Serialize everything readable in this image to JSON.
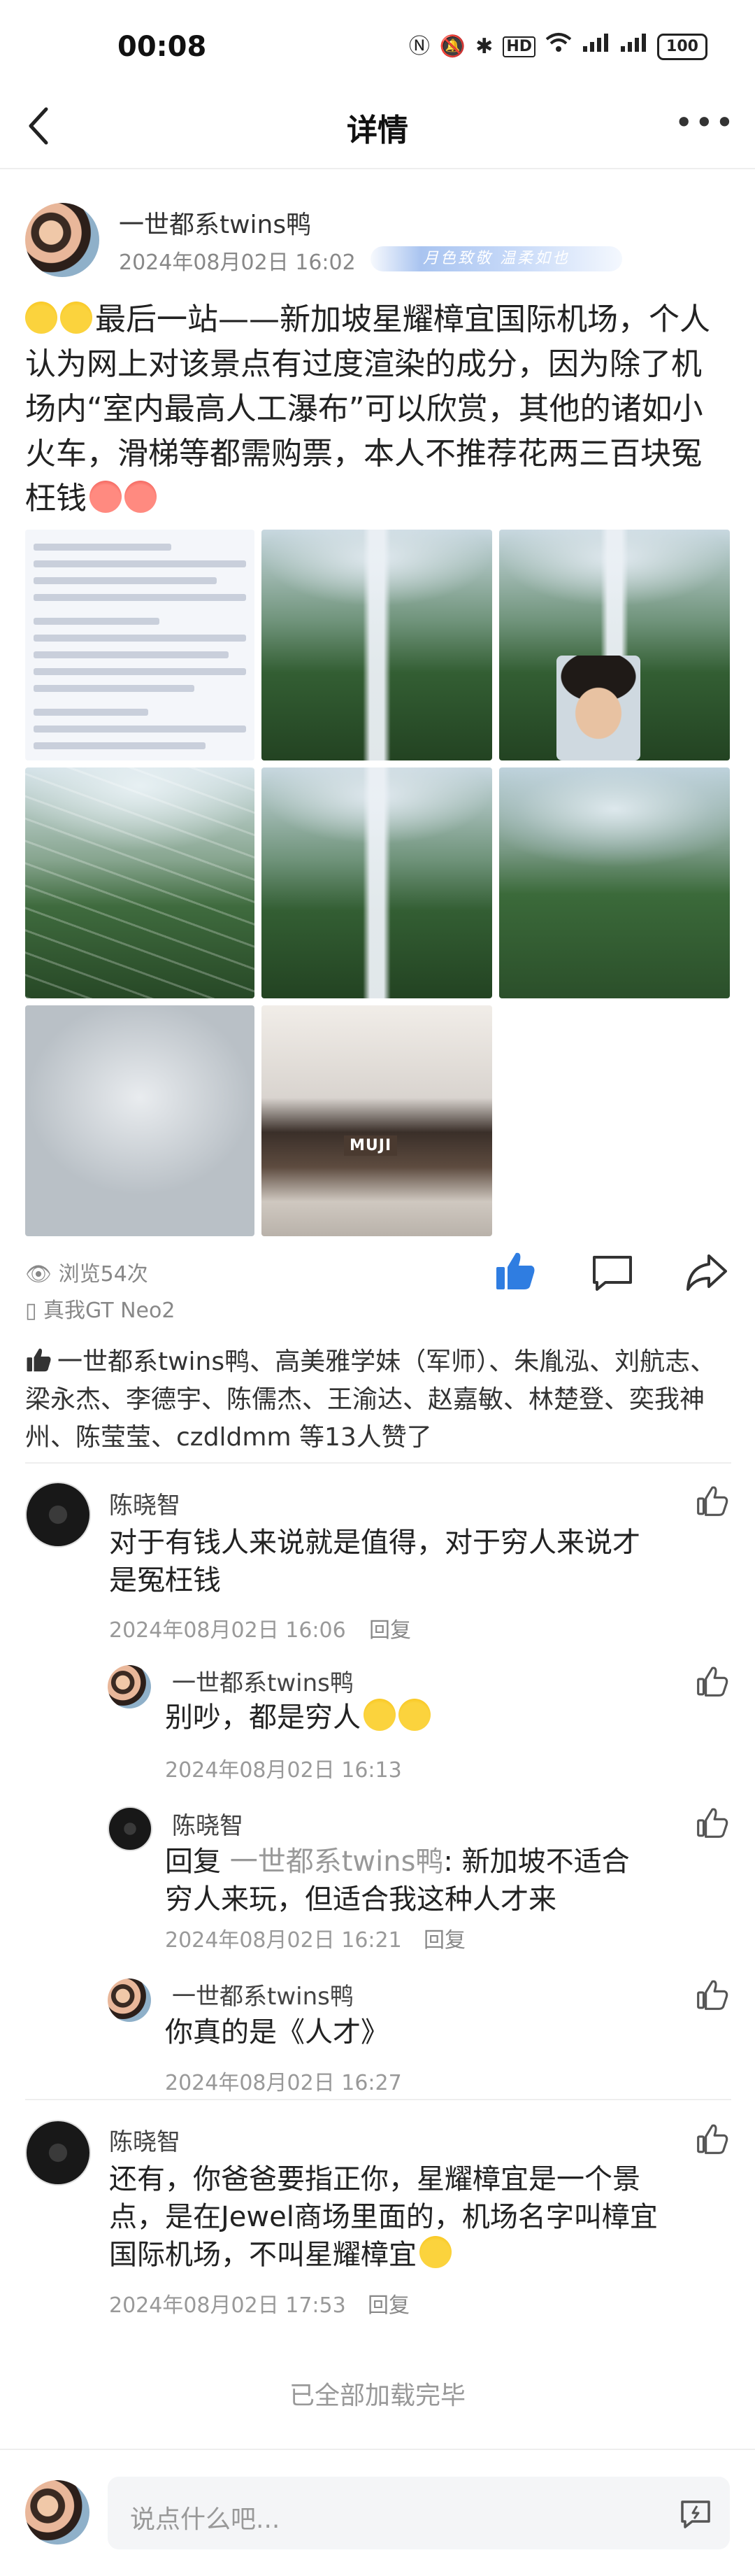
{
  "status_bar": {
    "time": "00:08",
    "icons": [
      "nfc-icon",
      "mute-icon",
      "bluetooth-icon",
      "hd-icon",
      "wifi-icon",
      "signal-4g-icon",
      "signal-5g-icon"
    ],
    "hd_label": "HD",
    "battery": "100"
  },
  "nav": {
    "title": "详情",
    "more": "•••"
  },
  "post": {
    "author": "一世都系twins鸭",
    "time": "2024年08月02日 16:02",
    "badge_text": "月色致敬  温柔如也",
    "body": "最后一站——新加坡星耀樟宜国际机场，个人认为网上对该景点有过度渲染的成分，因为除了机场内“室内最高人工瀑布”可以欣赏，其他的诸如小火车，滑梯等都需购票，本人不推荐花两三百块冤枉钱",
    "views": "浏览54次",
    "device": "真我GT Neo2",
    "photo_label_muji": "MUJI"
  },
  "likes": {
    "text": "一世都系twins鸭、高美雅学妹（军师）、朱胤泓、刘航志、梁永杰、李德宇、陈儒杰、王渝达、赵嘉敏、林楚登、奕我神州、陈莹莹、czdldmm 等13人赞了"
  },
  "comments": [
    {
      "name": "陈晓智",
      "text": "对于有钱人来说就是值得，对于穷人来说才是冤枉钱",
      "time": "2024年08月02日 16:06",
      "reply_label": "回复",
      "replies": [
        {
          "name": "一世都系twins鸭",
          "text": "别吵，都是穷人",
          "time": "2024年08月02日 16:13"
        },
        {
          "name": "陈晓智",
          "prefix": "回复",
          "ref": "一世都系twins鸭",
          "text": ": 新加坡不适合穷人来玩，但适合我这种人才来",
          "time": "2024年08月02日 16:21",
          "reply_label": "回复"
        },
        {
          "name": "一世都系twins鸭",
          "text": "你真的是《人才》",
          "time": "2024年08月02日 16:27"
        }
      ]
    },
    {
      "name": "陈晓智",
      "text": "还有，你爸爸要指正你，星耀樟宜是一个景点，是在Jewel商场里面的，机场名字叫樟宜国际机场，不叫星耀樟宜",
      "time": "2024年08月02日 17:53",
      "reply_label": "回复"
    }
  ],
  "footer": {
    "all_loaded": "已全部加载完毕",
    "input_placeholder": "说点什么吧..."
  }
}
